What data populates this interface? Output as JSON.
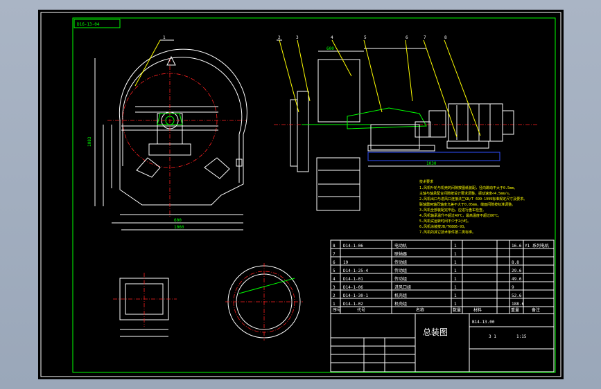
{
  "drawing": {
    "code_tag": "D16-13-04",
    "title": "总装图",
    "drawing_no": "B14-13.00",
    "scale": "1:15",
    "sheet": "3  1",
    "tech_req_title": "技术要求",
    "tech_req": [
      "1.风机叶轮与机壳的间隙按图纸装配，径向跳动不大于0.5mm。",
      "  主轴与轴承配合间隙按设计要求调整，振动速度<4.5mm/s。",
      "2.风机出口与进风口连接法兰GB/T 699-1999标准规定尺寸及要求。",
      "  联轴器两轴同轴度允差不大于0.05mm，端面间隙按标准调整。",
      "3.风机全部装配完毕后，应进行盘车检查。",
      "4.风机轴承温升不超过40℃，最高温度不超过80℃。",
      "5.风机试运转时间不少于2小时。",
      "6.风机涂装按JB/T6886-93。",
      "7.风机的其它技术条件按二类标准。"
    ],
    "bom_rows": [
      {
        "no": "8",
        "code": "D14-1-06",
        "name": "电动机",
        "qty": "1",
        "material": "",
        "weight": "16.6",
        "note": "Y1 系列电机"
      },
      {
        "no": "7",
        "code": "",
        "name": "联轴器",
        "qty": "1",
        "material": "",
        "weight": "",
        "note": ""
      },
      {
        "no": "6",
        "code": "19",
        "name": "传动组",
        "qty": "1",
        "material": "",
        "weight": "8.8",
        "note": ""
      },
      {
        "no": "5",
        "code": "D14-1-25-4",
        "name": "传动组",
        "qty": "1",
        "material": "",
        "weight": "29.6",
        "note": ""
      },
      {
        "no": "4",
        "code": "D14-1-01",
        "name": "传动组",
        "qty": "1",
        "material": "",
        "weight": "49.6",
        "note": ""
      },
      {
        "no": "3",
        "code": "D14-1-06",
        "name": "进风口组",
        "qty": "1",
        "material": "",
        "weight": "9",
        "note": ""
      },
      {
        "no": "2",
        "code": "D14-1-30-1",
        "name": "机壳组",
        "qty": "1",
        "material": "",
        "weight": "52.6",
        "note": ""
      },
      {
        "no": "1",
        "code": "D14-1-02",
        "name": "机壳组",
        "qty": "1",
        "material": "",
        "weight": "188.6",
        "note": ""
      }
    ],
    "bom_header": {
      "no": "序号",
      "code": "代号",
      "name": "名称",
      "qty": "数量",
      "material": "材料",
      "weight": "重量",
      "note": "备注"
    },
    "dims": {
      "left_width": "1060",
      "left_height": "1083",
      "inlet_width": "600",
      "side_top": "600",
      "base_span": "1030"
    },
    "leaders": [
      "1",
      "2",
      "3",
      "4",
      "5",
      "6",
      "7",
      "8"
    ],
    "colors": {
      "line": "#ffffff",
      "annotation": "#00ff00",
      "center": "#ff2020",
      "hidden": "#3050ff",
      "background": "#000000"
    }
  }
}
